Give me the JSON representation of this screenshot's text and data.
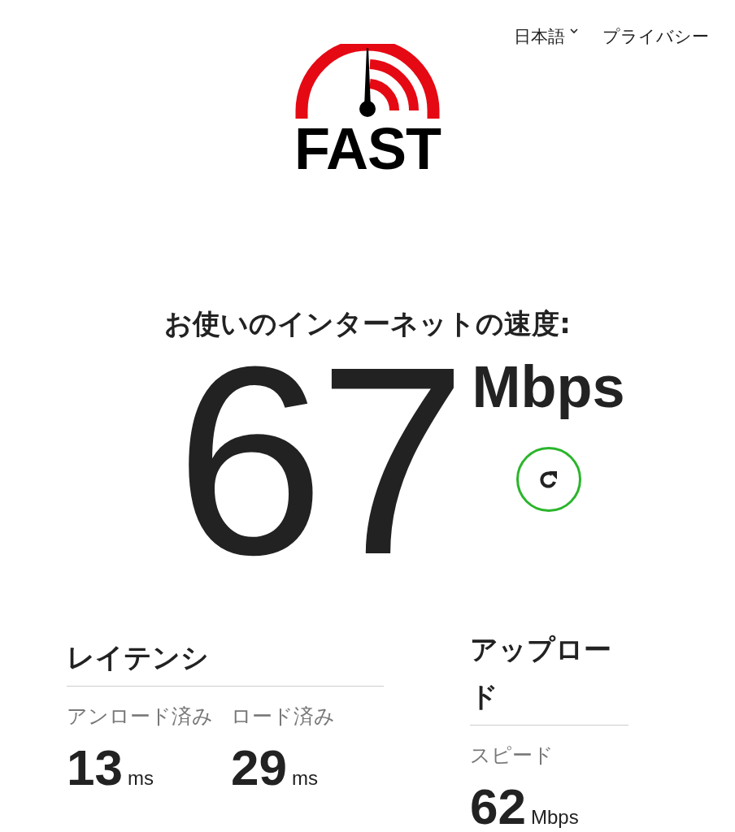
{
  "header": {
    "language": {
      "label": "日本語"
    },
    "links": [
      {
        "label": "プライバシー"
      }
    ]
  },
  "logo": {
    "text": "FAST"
  },
  "speed": {
    "title": "お使いのインターネットの速度:",
    "value": "67",
    "unit": "Mbps"
  },
  "latency": {
    "title": "レイテンシ",
    "items": [
      {
        "label": "アンロード済み",
        "value": "13",
        "unit": "ms"
      },
      {
        "label": "ロード済み",
        "value": "29",
        "unit": "ms"
      }
    ]
  },
  "upload": {
    "title": "アップロード",
    "items": [
      {
        "label": "スピード",
        "value": "62",
        "unit": "Mbps"
      }
    ]
  }
}
